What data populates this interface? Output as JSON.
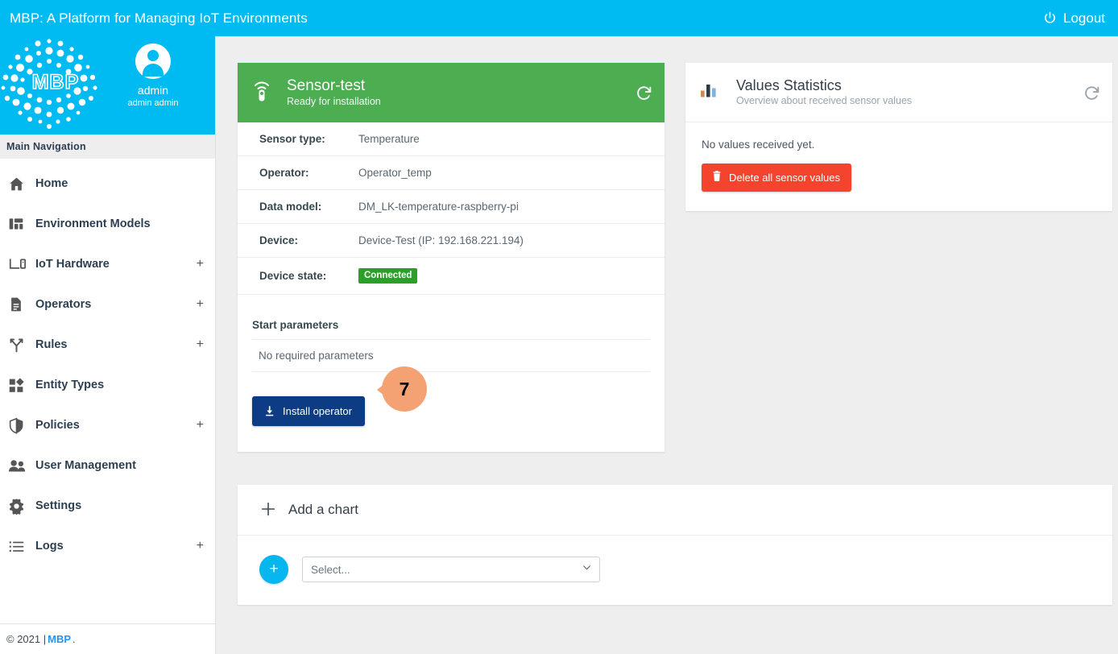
{
  "topbar": {
    "title": "MBP: A Platform for Managing IoT Environments",
    "logout_label": "Logout",
    "logout_icon": "power-icon",
    "background_color": "#00baf2"
  },
  "sidebar": {
    "logo_text": "MBP",
    "user": {
      "name": "admin",
      "full_name": "admin admin",
      "avatar_icon": "user-avatar-icon"
    },
    "nav_header": "Main Navigation",
    "items": [
      {
        "label": "Home",
        "icon": "home-icon",
        "expandable": false,
        "expand_label": ""
      },
      {
        "label": "Environment Models",
        "icon": "dashboard-icon",
        "expandable": false,
        "expand_label": ""
      },
      {
        "label": "IoT Hardware",
        "icon": "laptop-icon",
        "expandable": true,
        "expand_label": "+"
      },
      {
        "label": "Operators",
        "icon": "document-icon",
        "expandable": true,
        "expand_label": "+"
      },
      {
        "label": "Rules",
        "icon": "branch-icon",
        "expandable": true,
        "expand_label": "+"
      },
      {
        "label": "Entity Types",
        "icon": "shapes-icon",
        "expandable": false,
        "expand_label": ""
      },
      {
        "label": "Policies",
        "icon": "shield-icon",
        "expandable": true,
        "expand_label": "+"
      },
      {
        "label": "User Management",
        "icon": "users-icon",
        "expandable": false,
        "expand_label": ""
      },
      {
        "label": "Settings",
        "icon": "gear-icon",
        "expandable": false,
        "expand_label": ""
      },
      {
        "label": "Logs",
        "icon": "list-icon",
        "expandable": true,
        "expand_label": "+"
      }
    ]
  },
  "footer": {
    "copyright": "© 2021 |",
    "link_label": "MBP",
    "suffix": "."
  },
  "sensor_card": {
    "icon": "sensor-icon",
    "title": "Sensor-test",
    "subtitle": "Ready for installation",
    "refresh_icon": "refresh-icon",
    "header_color": "#4cae51",
    "details": [
      {
        "key": "Sensor type:",
        "value": "Temperature"
      },
      {
        "key": "Operator:",
        "value": "Operator_temp"
      },
      {
        "key": "Data model:",
        "value": "DM_LK-temperature-raspberry-pi"
      },
      {
        "key": "Device:",
        "value": "Device-Test (IP: 192.168.221.194)"
      }
    ],
    "device_state_key": "Device state:",
    "device_state_value": "Connected",
    "device_state_color": "#2aa02a",
    "start_parameters_title": "Start parameters",
    "start_parameters_empty": "No required parameters",
    "install_button_label": "Install operator",
    "install_button_icon": "download-icon",
    "install_button_color": "#0d3c85",
    "annotation_number": "7",
    "annotation_color": "#f4a273"
  },
  "stats_card": {
    "icon": "bar-chart-icon",
    "title": "Values Statistics",
    "subtitle": "Overview about received sensor values",
    "refresh_icon": "refresh-icon",
    "empty_message": "No values received yet.",
    "delete_button_label": "Delete all sensor values",
    "delete_button_icon": "trash-icon",
    "delete_button_color": "#f4442e"
  },
  "chart_card": {
    "add_icon": "plus-icon",
    "title": "Add a chart",
    "fab_label": "+",
    "fab_color": "#06b6ef",
    "select_value": "Select...",
    "select_chevron_icon": "chevron-down-icon"
  }
}
